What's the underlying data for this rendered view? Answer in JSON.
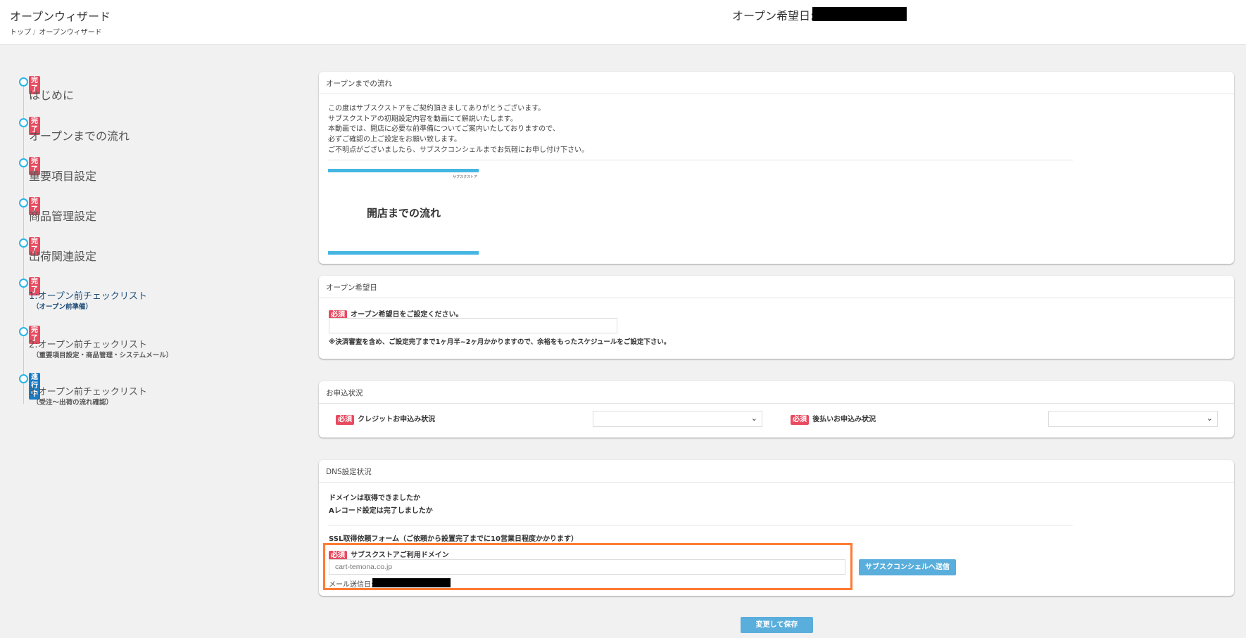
{
  "header": {
    "title": "オープンウィザード",
    "breadcrumb": [
      "トップ",
      "オープンウィザード"
    ],
    "breadcrumb_sep": "/",
    "open_date_label": "オープン希望日:"
  },
  "steps": [
    {
      "status": "完了",
      "label": "はじめに"
    },
    {
      "status": "完了",
      "label": "オープンまでの流れ"
    },
    {
      "status": "完了",
      "label": "重要項目設定"
    },
    {
      "status": "完了",
      "label": "商品管理設定"
    },
    {
      "status": "完了",
      "label": "出荷関連設定"
    },
    {
      "status": "完了",
      "label": "1:オープン前チェックリスト",
      "sub": "（オープン前準備）"
    },
    {
      "status": "完了",
      "label": "2:オープン前チェックリスト",
      "sub": "（重要項目設定・商品管理・システムメール）"
    },
    {
      "status": "進行中",
      "label": "3:オープン前チェックリスト",
      "sub": "（受注〜出荷の流れ確認）"
    }
  ],
  "flow": {
    "title": "オープンまでの流れ",
    "lines": [
      "この度はサブスクストアをご契約頂きましてありがとうございます。",
      "サブスクストアの初期設定内容を動画にて解説いたします。",
      "本動画では、開店に必要な前準備についてご案内いたしておりますので、",
      "必ずご確認の上ご設定をお願い致します。",
      "ご不明点がございましたら、サブスクコンシェルまでお気軽にお申し付け下さい。"
    ],
    "video_title": "開店までの流れ",
    "video_logo": "サブスクストア"
  },
  "open_date": {
    "title": "オープン希望日",
    "required": "必須",
    "label": "オープン希望日をご設定ください。",
    "value": "",
    "note": "※決済審査を含め、ご設定完了まで1ヶ月半~2ヶ月かかりますので、余裕をもったスケジュールをご設定下さい。"
  },
  "application": {
    "title": "お申込状況",
    "required": "必須",
    "credit_label": "クレジットお申込み状況",
    "credit_value": "",
    "deferred_label": "後払いお申込み状況",
    "deferred_value": ""
  },
  "dns": {
    "title": "DNS設定状況",
    "q1": "ドメインは取得できましたか",
    "q2": "Aレコード設定は完了しましたか",
    "ssl_title": "SSL取得依頼フォーム（ご依頼から設置完了までに10営業日程度かかります）",
    "required": "必須",
    "domain_label": "サブスクストアご利用ドメイン",
    "domain_placeholder": "cart-temona.co.jp",
    "mail_label": "メール送信日:",
    "send_button": "サブスクコンシェルへ送信"
  },
  "save_button": "変更して保存",
  "colors": {
    "required": "#e84a5f",
    "in_progress": "#1a7bc4",
    "step_dot": "#2bb3e6",
    "button": "#5aaedc",
    "highlight": "#ff7a33"
  }
}
